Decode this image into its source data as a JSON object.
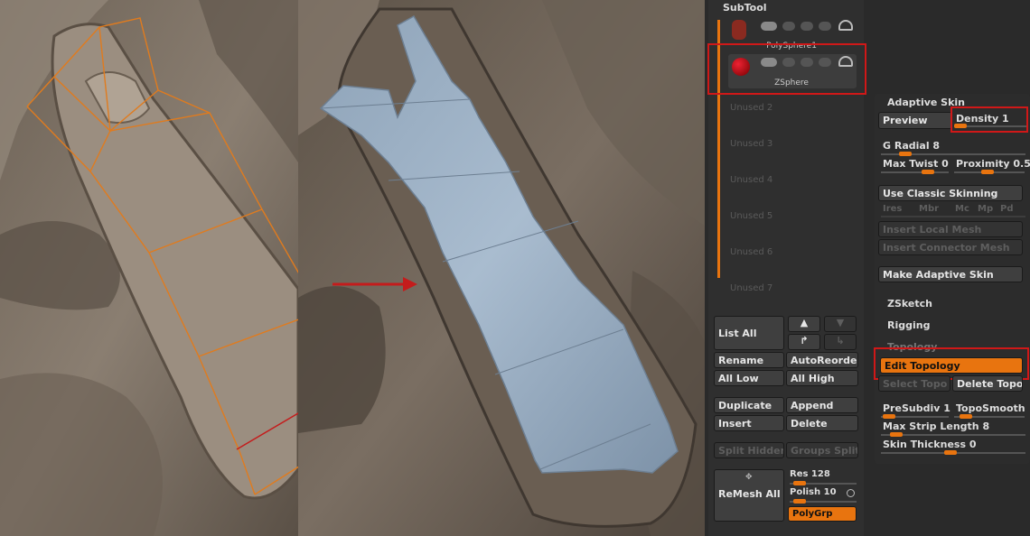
{
  "subtool": {
    "title": "SubTool",
    "items": [
      {
        "label": "PolySphere1"
      },
      {
        "label": "ZSphere"
      }
    ],
    "unused": [
      "Unused 2",
      "Unused 3",
      "Unused 4",
      "Unused 5",
      "Unused 6",
      "Unused 7"
    ],
    "buttons": {
      "list_all": "List All",
      "rename": "Rename",
      "auto_reorder": "AutoReorder",
      "all_low": "All Low",
      "all_high": "All High",
      "duplicate": "Duplicate",
      "append": "Append",
      "insert": "Insert",
      "delete": "Delete",
      "split_hidden": "Split Hidden",
      "groups_split": "Groups Split",
      "remesh_all": "ReMesh All",
      "res": "Res 128",
      "polish": "Polish 10",
      "polygrp": "PolyGrp"
    }
  },
  "adaptive_skin": {
    "title": "Adaptive Skin",
    "preview": "Preview",
    "density": "Density 1",
    "g_radial": "G Radial 8",
    "max_twist": "Max Twist 0",
    "proximity": "Proximity 0.5",
    "use_classic": "Use Classic Skinning",
    "ires": "Ires",
    "mbr": "Mbr",
    "mc": "Mc",
    "mp": "Mp",
    "pd": "Pd",
    "insert_local": "Insert Local Mesh",
    "insert_connector": "Insert Connector Mesh",
    "make_adaptive": "Make Adaptive Skin"
  },
  "zsketch": "ZSketch",
  "rigging": "Rigging",
  "topology": {
    "title": "Topology",
    "edit_topology": "Edit Topology",
    "select_topo": "Select Topo",
    "delete_topo": "Delete Topo",
    "presubdiv": "PreSubdiv 1",
    "toposmooth": "TopoSmooth",
    "max_strip": "Max Strip Length 8",
    "skin_thickness": "Skin Thickness 0"
  },
  "colors": {
    "accent": "#e8740f",
    "highlight_box": "#d01818",
    "mesh_blue": "#9fb4c8",
    "clay": "#7b6e62"
  }
}
